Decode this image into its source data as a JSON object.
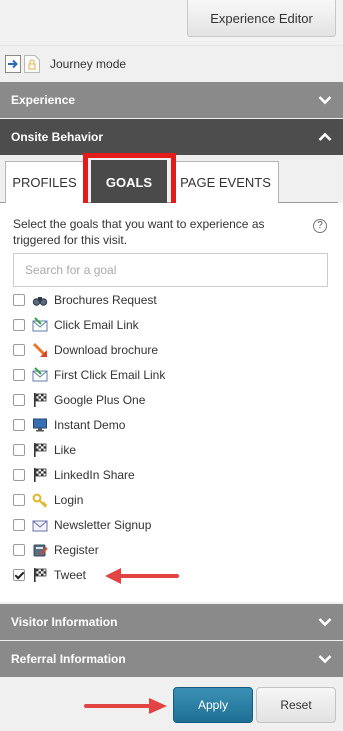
{
  "toolbar": {
    "experience_editor": "Experience Editor"
  },
  "journey": {
    "label": "Journey mode"
  },
  "sections": {
    "experience": "Experience",
    "onsite_behavior": "Onsite Behavior",
    "visitor_information": "Visitor Information",
    "referral_information": "Referral Information"
  },
  "tabs": [
    {
      "label": "PROFILES",
      "active": false
    },
    {
      "label": "GOALS",
      "active": true
    },
    {
      "label": "PAGE EVENTS",
      "active": false
    }
  ],
  "goals_panel": {
    "instruction": "Select the goals that you want to experience as triggered for this visit.",
    "help_icon": "question-circle-icon",
    "search_placeholder": "Search for a goal",
    "goals": [
      {
        "label": "Brochures Request",
        "checked": false,
        "icon": "binoculars-icon"
      },
      {
        "label": "Click Email Link",
        "checked": false,
        "icon": "email-link-icon"
      },
      {
        "label": "Download brochure",
        "checked": false,
        "icon": "download-icon"
      },
      {
        "label": "First Click Email Link",
        "checked": false,
        "icon": "email-link-icon"
      },
      {
        "label": "Google Plus One",
        "checked": false,
        "icon": "flag-icon"
      },
      {
        "label": "Instant Demo",
        "checked": false,
        "icon": "monitor-icon"
      },
      {
        "label": "Like",
        "checked": false,
        "icon": "flag-icon"
      },
      {
        "label": "LinkedIn Share",
        "checked": false,
        "icon": "flag-icon"
      },
      {
        "label": "Login",
        "checked": false,
        "icon": "key-icon"
      },
      {
        "label": "Newsletter Signup",
        "checked": false,
        "icon": "envelope-icon"
      },
      {
        "label": "Register",
        "checked": false,
        "icon": "register-icon"
      },
      {
        "label": "Tweet",
        "checked": true,
        "icon": "flag-icon"
      }
    ]
  },
  "buttons": {
    "apply": "Apply",
    "reset": "Reset"
  },
  "colors": {
    "section_header": "#8a8a8a",
    "section_header_active": "#4d4d4d",
    "apply_button": "#1f6f95",
    "annotation_red": "#e21b1b"
  }
}
